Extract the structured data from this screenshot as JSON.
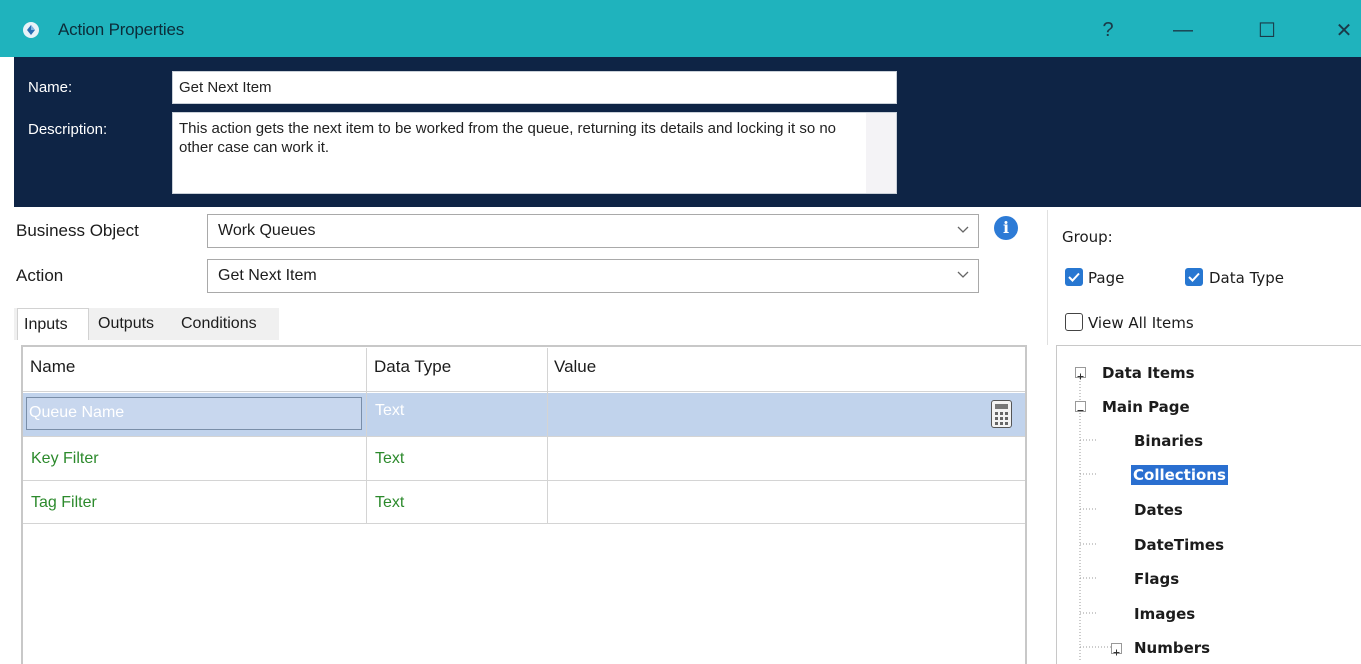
{
  "window": {
    "title": "Action Properties",
    "help_glyph": "?",
    "minimize_glyph": "—",
    "maximize_glyph": "☐",
    "close_glyph": "✕",
    "app_icon": "blueprism-icon",
    "colors": {
      "titlebar": "#1fb3bd",
      "header": "#0e2445",
      "selection": "#2a6fd0",
      "green_text": "#2c8a2c"
    }
  },
  "header": {
    "name_label": "Name:",
    "name_value": "Get Next Item",
    "description_label": "Description:",
    "description_value": "This action gets the next item to be worked from the queue, returning its details and locking it so no other case can work it."
  },
  "fields": {
    "business_object_label": "Business Object",
    "business_object_value": "Work Queues",
    "action_label": "Action",
    "action_value": "Get Next Item",
    "info_glyph": "i"
  },
  "tabs": [
    {
      "label": "Inputs",
      "active": true
    },
    {
      "label": "Outputs",
      "active": false
    },
    {
      "label": "Conditions",
      "active": false
    }
  ],
  "grid": {
    "headers": [
      "Name",
      "Data Type",
      "Value"
    ],
    "rows": [
      {
        "name": "Queue Name",
        "type": "Text",
        "value": "",
        "selected": true
      },
      {
        "name": "Key Filter",
        "type": "Text",
        "value": ""
      },
      {
        "name": "Tag Filter",
        "type": "Text",
        "value": ""
      }
    ],
    "calculator_icon": "calculator-icon"
  },
  "group": {
    "label": "Group:",
    "page_label": "Page",
    "page_checked": true,
    "datatype_label": "Data Type",
    "datatype_checked": true,
    "viewall_label": "View All Items",
    "viewall_checked": false
  },
  "tree": {
    "expander_plus": "+",
    "expander_minus": "−",
    "items": [
      {
        "label": "Data Items",
        "level": 0,
        "expander": "plus"
      },
      {
        "label": "Main Page",
        "level": 0,
        "expander": "minus"
      },
      {
        "label": "Binaries",
        "level": 1
      },
      {
        "label": "Collections",
        "level": 1,
        "selected": true
      },
      {
        "label": "Dates",
        "level": 1
      },
      {
        "label": "DateTimes",
        "level": 1
      },
      {
        "label": "Flags",
        "level": 1
      },
      {
        "label": "Images",
        "level": 1
      },
      {
        "label": "Numbers",
        "level": 1,
        "expander": "plus"
      }
    ]
  }
}
